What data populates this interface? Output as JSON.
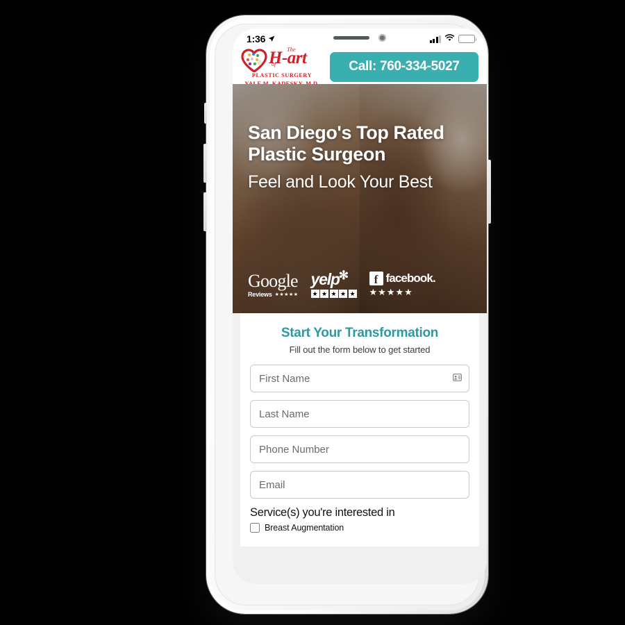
{
  "device": {
    "status_bar": {
      "time": "1:36",
      "location_icon": "location-arrow-icon",
      "signal_icon": "cellular-signal-icon",
      "wifi_icon": "wifi-icon",
      "battery_icon": "battery-icon"
    }
  },
  "header": {
    "logo": {
      "the": "The",
      "word": "H-art",
      "of": "of",
      "subtitle": "PLASTIC SURGERY",
      "doctor": "YALE M. KADESKY, M.D.",
      "color": "#cf2027",
      "icon": "heart-palette-logo-icon"
    },
    "call_button": {
      "label": "Call: 760-334-5027",
      "color": "#3aafb0"
    }
  },
  "hero": {
    "headline": "San Diego's Top Rated Plastic Surgeon",
    "subheadline": "Feel and Look Your Best",
    "badges": [
      {
        "name": "google-reviews-badge",
        "brand": "Google",
        "caption": "Reviews",
        "stars": "★★★★★"
      },
      {
        "name": "yelp-badge",
        "brand": "yelp",
        "burst": "✻",
        "stars": [
          "★",
          "★",
          "★",
          "★",
          "★"
        ]
      },
      {
        "name": "facebook-badge",
        "mark": "f",
        "brand": "facebook.",
        "stars": "★★★★★"
      }
    ]
  },
  "form": {
    "title": "Start Your Transformation",
    "title_color": "#2d9a9f",
    "subtitle": "Fill out the form below to get started",
    "fields": [
      {
        "name": "first-name-input",
        "placeholder": "First Name",
        "value": "",
        "icon": "contact-card-icon"
      },
      {
        "name": "last-name-input",
        "placeholder": "Last Name",
        "value": ""
      },
      {
        "name": "phone-number-input",
        "placeholder": "Phone Number",
        "value": ""
      },
      {
        "name": "email-input",
        "placeholder": "Email",
        "value": ""
      }
    ],
    "services_label": "Service(s) you're interested in",
    "services": [
      {
        "label": "Breast Augmentation",
        "checked": false
      }
    ]
  }
}
